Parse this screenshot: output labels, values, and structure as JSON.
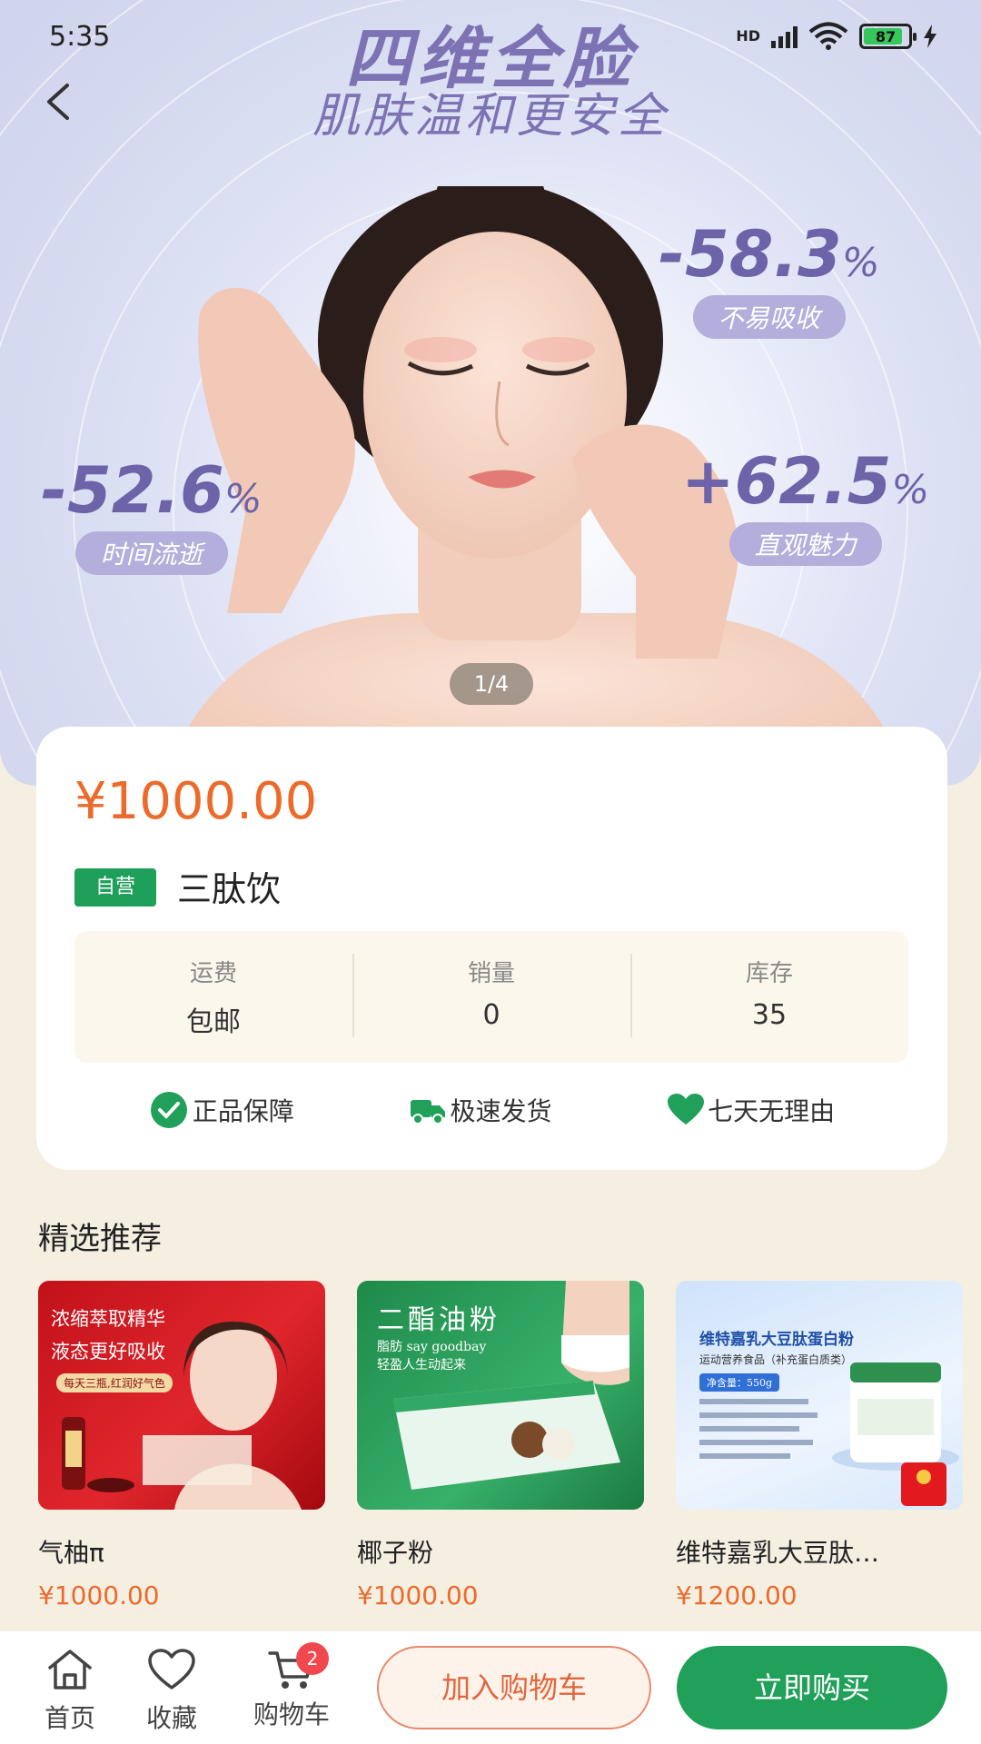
{
  "status_bar": {
    "time": "5:35",
    "network": "HD",
    "battery": "87"
  },
  "hero": {
    "title_line1": "四维全脸",
    "title_line2": "肌肤温和更安全",
    "stats": [
      {
        "value": "-58.3",
        "unit": "%",
        "label": "不易吸收"
      },
      {
        "value": "-52.6",
        "unit": "%",
        "label": "时间流逝"
      },
      {
        "value": "+62.5",
        "unit": "%",
        "label": "直观魅力"
      }
    ],
    "pager": "1/4"
  },
  "product": {
    "price": "¥1000.00",
    "tag": "自营",
    "name": "三肽饮",
    "stats": [
      {
        "label": "运费",
        "value": "包邮"
      },
      {
        "label": "销量",
        "value": "0"
      },
      {
        "label": "库存",
        "value": "35"
      }
    ],
    "guarantees": [
      "正品保障",
      "极速发货",
      "七天无理由"
    ]
  },
  "recommend": {
    "title": "精选推荐",
    "items": [
      {
        "name": "气柚π",
        "price": "¥1000.00",
        "image_text": [
          "浓缩萃取精华",
          "液态更好吸收",
          "每天三瓶,红润好气色"
        ]
      },
      {
        "name": "椰子粉",
        "price": "¥1000.00",
        "image_text": [
          "二酯油粉",
          "脂肪 say goodbay",
          "轻盈人生动起来"
        ]
      },
      {
        "name": "维特嘉乳大豆肽…",
        "price": "¥1200.00",
        "image_text": [
          "维特嘉乳大豆肽蛋白粉",
          "运动营养食品（补充蛋白质类）",
          "净含量：550g"
        ]
      }
    ]
  },
  "bottom_bar": {
    "home": "首页",
    "favorite": "收藏",
    "cart": "购物车",
    "cart_count": "2",
    "add_to_cart": "加入购物车",
    "buy_now": "立即购买"
  }
}
